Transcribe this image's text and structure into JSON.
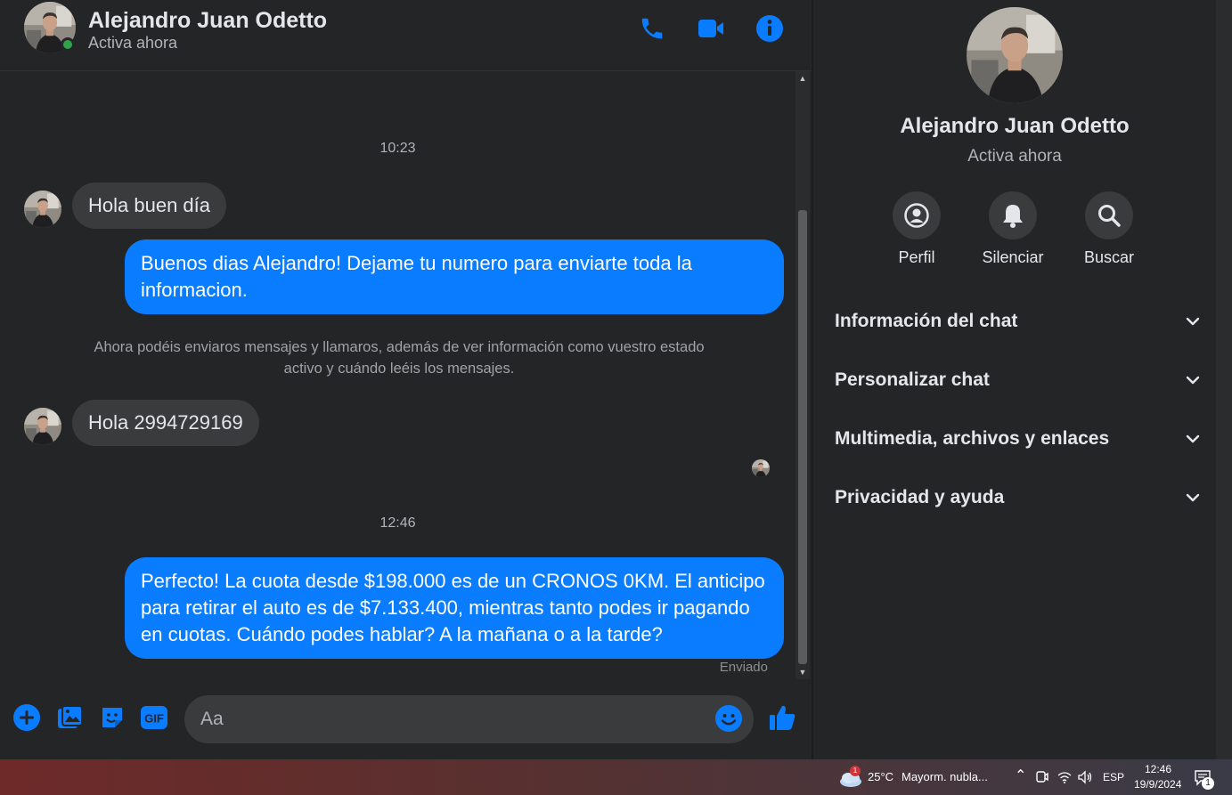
{
  "contact": {
    "name": "Alejandro Juan Odetto",
    "status": "Activa ahora"
  },
  "colors": {
    "accent": "#0a7cff",
    "online": "#31a24c",
    "background": "#242526",
    "bubble_in": "#3a3b3c"
  },
  "header": {
    "icons": [
      "phone-icon",
      "video-icon",
      "info-icon"
    ]
  },
  "messages": {
    "time1": "10:23",
    "in1": "Hola buen día",
    "out1": "Buenos dias Alejandro! Dejame tu numero para enviarte toda la informacion.",
    "notice": "Ahora podéis enviaros mensajes y llamaros, además de ver información como vuestro estado activo y cuándo leéis los mensajes.",
    "in2": "Hola 2994729169",
    "time2": "12:46",
    "out2": "Perfecto! La cuota desde $198.000 es de un CRONOS 0KM. El anticipo para retirar el auto es de $7.133.400, mientras tanto podes ir pagando en cuotas. Cuándo podes hablar? A la mañana o a la tarde?",
    "sent": "Enviado"
  },
  "composer": {
    "placeholder": "Aa",
    "icons": [
      "plus-icon",
      "image-icon",
      "sticker-icon",
      "gif-icon",
      "emoji-icon",
      "like-icon"
    ]
  },
  "info_panel": {
    "actions": [
      {
        "label": "Perfil",
        "icon": "profile-icon"
      },
      {
        "label": "Silenciar",
        "icon": "bell-icon"
      },
      {
        "label": "Buscar",
        "icon": "search-icon"
      }
    ],
    "sections": [
      "Información del chat",
      "Personalizar chat",
      "Multimedia, archivos y enlaces",
      "Privacidad y ayuda"
    ]
  },
  "taskbar": {
    "weather_badge": "1",
    "temperature": "25°C",
    "weather": "Mayorm. nubla...",
    "language": "ESP",
    "time": "12:46",
    "date": "19/9/2024",
    "notifications": "1"
  }
}
